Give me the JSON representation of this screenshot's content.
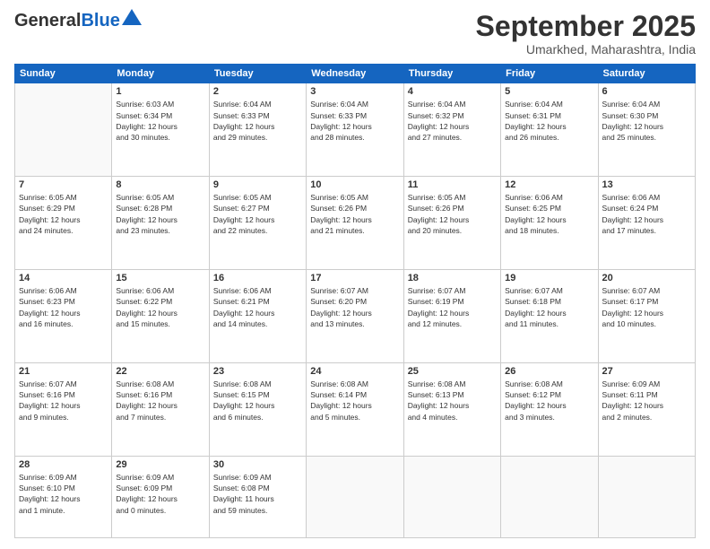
{
  "header": {
    "logo_general": "General",
    "logo_blue": "Blue",
    "month_title": "September 2025",
    "subtitle": "Umarkhed, Maharashtra, India"
  },
  "days_of_week": [
    "Sunday",
    "Monday",
    "Tuesday",
    "Wednesday",
    "Thursday",
    "Friday",
    "Saturday"
  ],
  "weeks": [
    [
      {
        "day": "",
        "info": ""
      },
      {
        "day": "1",
        "info": "Sunrise: 6:03 AM\nSunset: 6:34 PM\nDaylight: 12 hours\nand 30 minutes."
      },
      {
        "day": "2",
        "info": "Sunrise: 6:04 AM\nSunset: 6:33 PM\nDaylight: 12 hours\nand 29 minutes."
      },
      {
        "day": "3",
        "info": "Sunrise: 6:04 AM\nSunset: 6:33 PM\nDaylight: 12 hours\nand 28 minutes."
      },
      {
        "day": "4",
        "info": "Sunrise: 6:04 AM\nSunset: 6:32 PM\nDaylight: 12 hours\nand 27 minutes."
      },
      {
        "day": "5",
        "info": "Sunrise: 6:04 AM\nSunset: 6:31 PM\nDaylight: 12 hours\nand 26 minutes."
      },
      {
        "day": "6",
        "info": "Sunrise: 6:04 AM\nSunset: 6:30 PM\nDaylight: 12 hours\nand 25 minutes."
      }
    ],
    [
      {
        "day": "7",
        "info": "Sunrise: 6:05 AM\nSunset: 6:29 PM\nDaylight: 12 hours\nand 24 minutes."
      },
      {
        "day": "8",
        "info": "Sunrise: 6:05 AM\nSunset: 6:28 PM\nDaylight: 12 hours\nand 23 minutes."
      },
      {
        "day": "9",
        "info": "Sunrise: 6:05 AM\nSunset: 6:27 PM\nDaylight: 12 hours\nand 22 minutes."
      },
      {
        "day": "10",
        "info": "Sunrise: 6:05 AM\nSunset: 6:26 PM\nDaylight: 12 hours\nand 21 minutes."
      },
      {
        "day": "11",
        "info": "Sunrise: 6:05 AM\nSunset: 6:26 PM\nDaylight: 12 hours\nand 20 minutes."
      },
      {
        "day": "12",
        "info": "Sunrise: 6:06 AM\nSunset: 6:25 PM\nDaylight: 12 hours\nand 18 minutes."
      },
      {
        "day": "13",
        "info": "Sunrise: 6:06 AM\nSunset: 6:24 PM\nDaylight: 12 hours\nand 17 minutes."
      }
    ],
    [
      {
        "day": "14",
        "info": "Sunrise: 6:06 AM\nSunset: 6:23 PM\nDaylight: 12 hours\nand 16 minutes."
      },
      {
        "day": "15",
        "info": "Sunrise: 6:06 AM\nSunset: 6:22 PM\nDaylight: 12 hours\nand 15 minutes."
      },
      {
        "day": "16",
        "info": "Sunrise: 6:06 AM\nSunset: 6:21 PM\nDaylight: 12 hours\nand 14 minutes."
      },
      {
        "day": "17",
        "info": "Sunrise: 6:07 AM\nSunset: 6:20 PM\nDaylight: 12 hours\nand 13 minutes."
      },
      {
        "day": "18",
        "info": "Sunrise: 6:07 AM\nSunset: 6:19 PM\nDaylight: 12 hours\nand 12 minutes."
      },
      {
        "day": "19",
        "info": "Sunrise: 6:07 AM\nSunset: 6:18 PM\nDaylight: 12 hours\nand 11 minutes."
      },
      {
        "day": "20",
        "info": "Sunrise: 6:07 AM\nSunset: 6:17 PM\nDaylight: 12 hours\nand 10 minutes."
      }
    ],
    [
      {
        "day": "21",
        "info": "Sunrise: 6:07 AM\nSunset: 6:16 PM\nDaylight: 12 hours\nand 9 minutes."
      },
      {
        "day": "22",
        "info": "Sunrise: 6:08 AM\nSunset: 6:16 PM\nDaylight: 12 hours\nand 7 minutes."
      },
      {
        "day": "23",
        "info": "Sunrise: 6:08 AM\nSunset: 6:15 PM\nDaylight: 12 hours\nand 6 minutes."
      },
      {
        "day": "24",
        "info": "Sunrise: 6:08 AM\nSunset: 6:14 PM\nDaylight: 12 hours\nand 5 minutes."
      },
      {
        "day": "25",
        "info": "Sunrise: 6:08 AM\nSunset: 6:13 PM\nDaylight: 12 hours\nand 4 minutes."
      },
      {
        "day": "26",
        "info": "Sunrise: 6:08 AM\nSunset: 6:12 PM\nDaylight: 12 hours\nand 3 minutes."
      },
      {
        "day": "27",
        "info": "Sunrise: 6:09 AM\nSunset: 6:11 PM\nDaylight: 12 hours\nand 2 minutes."
      }
    ],
    [
      {
        "day": "28",
        "info": "Sunrise: 6:09 AM\nSunset: 6:10 PM\nDaylight: 12 hours\nand 1 minute."
      },
      {
        "day": "29",
        "info": "Sunrise: 6:09 AM\nSunset: 6:09 PM\nDaylight: 12 hours\nand 0 minutes."
      },
      {
        "day": "30",
        "info": "Sunrise: 6:09 AM\nSunset: 6:08 PM\nDaylight: 11 hours\nand 59 minutes."
      },
      {
        "day": "",
        "info": ""
      },
      {
        "day": "",
        "info": ""
      },
      {
        "day": "",
        "info": ""
      },
      {
        "day": "",
        "info": ""
      }
    ]
  ]
}
